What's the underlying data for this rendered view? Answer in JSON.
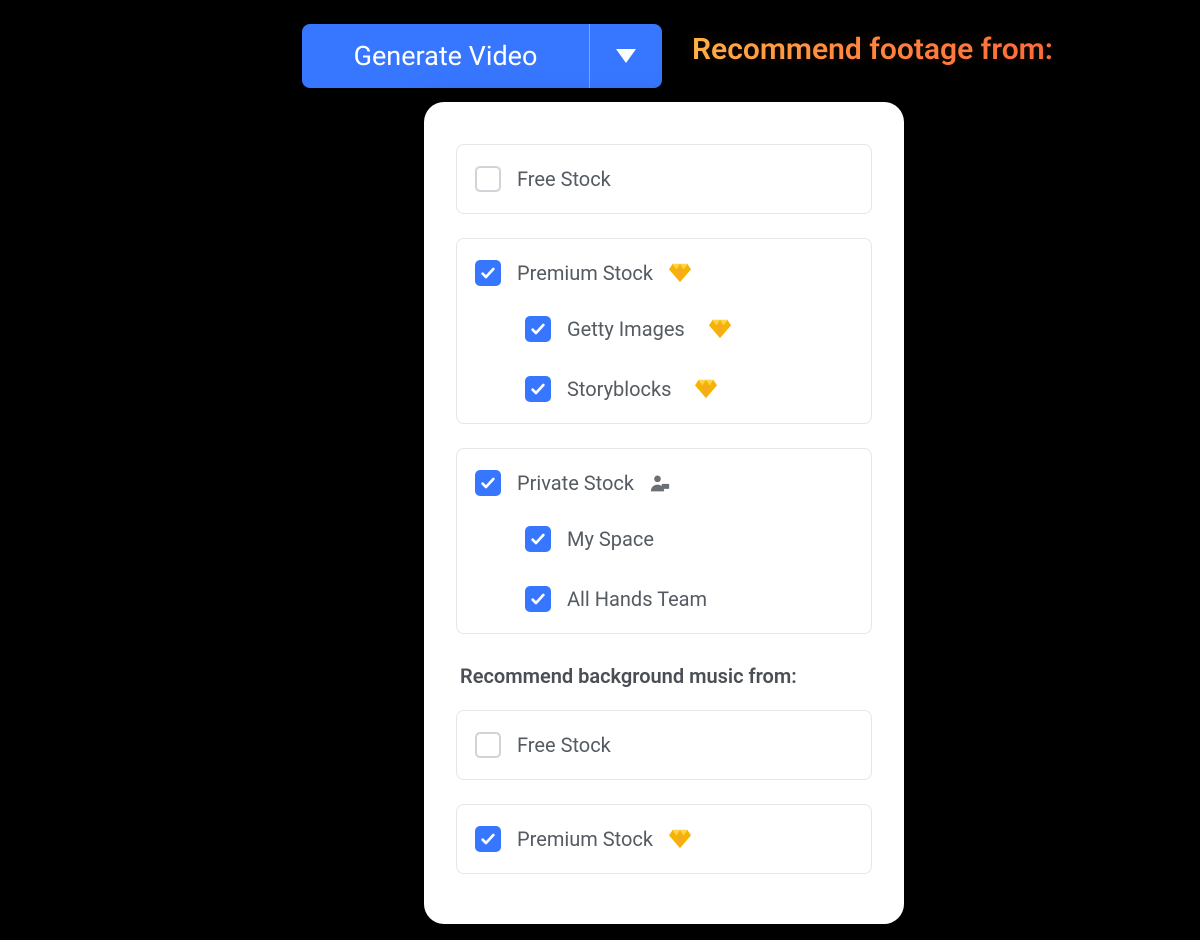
{
  "generate": {
    "label": "Generate Video"
  },
  "callout": {
    "text": "Recommend footage from:"
  },
  "colors": {
    "primary": "#3776ff",
    "gradientA": "#ffb347",
    "gradientB": "#ff6a3d"
  },
  "dropdown": {
    "footage": {
      "free": {
        "label": "Free Stock",
        "checked": false
      },
      "premium": {
        "label": "Premium Stock",
        "checked": true,
        "children": {
          "getty": {
            "label": "Getty Images",
            "checked": true
          },
          "storyblocks": {
            "label": "Storyblocks",
            "checked": true
          }
        }
      },
      "private": {
        "label": "Private Stock",
        "checked": true,
        "children": {
          "myspace": {
            "label": "My Space",
            "checked": true
          },
          "allhands": {
            "label": "All Hands Team",
            "checked": true
          }
        }
      }
    },
    "music": {
      "heading": "Recommend background music from:",
      "free": {
        "label": "Free Stock",
        "checked": false
      },
      "premium": {
        "label": "Premium Stock",
        "checked": true
      }
    }
  }
}
